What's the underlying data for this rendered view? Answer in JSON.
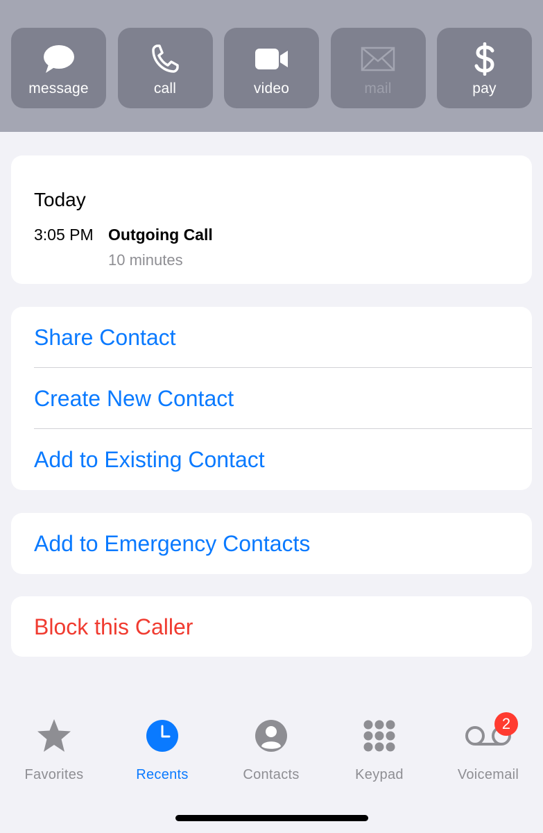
{
  "actions": [
    {
      "label": "message",
      "icon": "message-icon",
      "enabled": true
    },
    {
      "label": "call",
      "icon": "phone-icon",
      "enabled": true
    },
    {
      "label": "video",
      "icon": "video-icon",
      "enabled": true
    },
    {
      "label": "mail",
      "icon": "mail-icon",
      "enabled": false
    },
    {
      "label": "pay",
      "icon": "dollar-icon",
      "enabled": true
    }
  ],
  "recent": {
    "day": "Today",
    "time": "3:05 PM",
    "call_type": "Outgoing Call",
    "duration": "10 minutes"
  },
  "options": {
    "share_contact": "Share Contact",
    "create_new_contact": "Create New Contact",
    "add_to_existing": "Add to Existing Contact",
    "add_to_emergency": "Add to Emergency Contacts",
    "block_caller": "Block this Caller"
  },
  "tabs": [
    {
      "label": "Favorites",
      "icon": "star-icon",
      "active": false
    },
    {
      "label": "Recents",
      "icon": "clock-icon",
      "active": true
    },
    {
      "label": "Contacts",
      "icon": "person-icon",
      "active": false
    },
    {
      "label": "Keypad",
      "icon": "keypad-icon",
      "active": false
    },
    {
      "label": "Voicemail",
      "icon": "voicemail-icon",
      "active": false,
      "badge": "2"
    }
  ],
  "colors": {
    "accent": "#0a7aff",
    "destructive": "#f03b30",
    "header_bg": "#a4a6b3",
    "action_bg": "#7f818f",
    "badge": "#ff3b30"
  }
}
